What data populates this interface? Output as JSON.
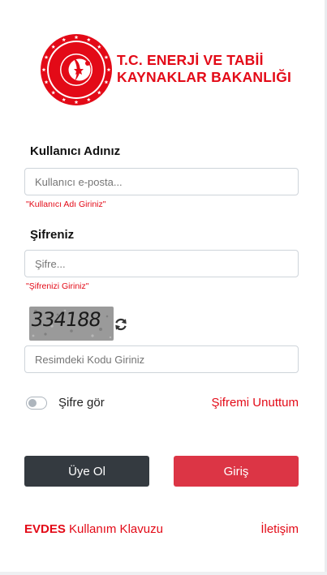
{
  "logo": {
    "line1": "T.C. ENERJİ VE TABİİ",
    "line2": "KAYNAKLAR BAKANLIĞI",
    "brand_color": "#e30a17",
    "icon": "ministry-seal-icon"
  },
  "username": {
    "label": "Kullanıcı Adınız",
    "placeholder": "Kullanıcı e-posta...",
    "value": "",
    "error": "\"Kullanıcı Adı Giriniz\""
  },
  "password": {
    "label": "Şifreniz",
    "placeholder": "Şifre...",
    "value": "",
    "error": "\"Şifrenizi Giriniz\""
  },
  "captcha": {
    "code": "334188",
    "refresh_icon": "refresh-icon",
    "input_placeholder": "Resimdeki Kodu Giriniz"
  },
  "options": {
    "show_password_label": "Şifre gör",
    "show_password_on": false,
    "forgot_password": "Şifremi Unuttum"
  },
  "buttons": {
    "register": "Üye Ol",
    "login": "Giriş",
    "register_color": "#343a40",
    "login_color": "#dc3545"
  },
  "footer": {
    "brand": "EVDES",
    "guide": "Kullanım Klavuzu",
    "contact": "İletişim"
  }
}
